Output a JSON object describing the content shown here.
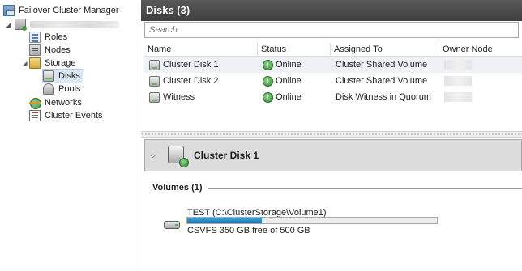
{
  "nav": {
    "root_label": "Failover Cluster Manager",
    "cluster_name": "",
    "items": [
      {
        "label": "Roles"
      },
      {
        "label": "Nodes"
      },
      {
        "label": "Storage"
      },
      {
        "label": "Disks"
      },
      {
        "label": "Pools"
      },
      {
        "label": "Networks"
      },
      {
        "label": "Cluster Events"
      }
    ],
    "selected": "Disks"
  },
  "pane": {
    "title": "Disks (3)",
    "search_placeholder": "Search",
    "columns": [
      "Name",
      "Status",
      "Assigned To",
      "Owner Node"
    ],
    "rows": [
      {
        "name": "Cluster Disk 1",
        "status": "Online",
        "assigned_to": "Cluster Shared Volume",
        "owner": ""
      },
      {
        "name": "Cluster Disk 2",
        "status": "Online",
        "assigned_to": "Cluster Shared Volume",
        "owner": ""
      },
      {
        "name": "Witness",
        "status": "Online",
        "assigned_to": "Disk Witness in Quorum",
        "owner": ""
      }
    ]
  },
  "detail": {
    "title": "Cluster Disk 1",
    "volumes_label": "Volumes (1)",
    "volume": {
      "name": "TEST (C:\\ClusterStorage\\Volume1)",
      "free_text": "CSVFS 350 GB free of 500 GB",
      "used_fraction": 0.3
    }
  },
  "colors": {
    "header_bg": "#4a4a4a",
    "status_ok": "#3a963a",
    "progress": "#2a8ccb",
    "selection": "#dde7f3"
  },
  "icons": [
    "cluster-manager-icon",
    "cluster-icon",
    "roles-icon",
    "nodes-icon",
    "storage-icon",
    "disks-icon",
    "pools-icon",
    "networks-icon",
    "events-icon",
    "disk-icon",
    "online-status-icon",
    "collapse-chevron-icon",
    "volume-drive-icon"
  ]
}
